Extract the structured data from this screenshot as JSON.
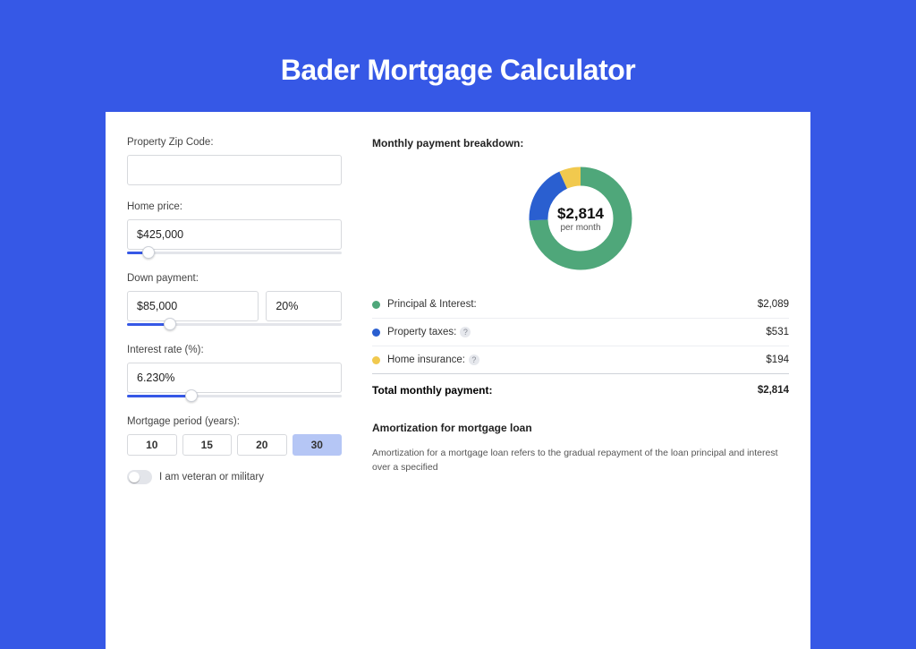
{
  "title": "Bader Mortgage Calculator",
  "form": {
    "zip_label": "Property Zip Code:",
    "zip_value": "",
    "home_price_label": "Home price:",
    "home_price_value": "$425,000",
    "home_price_slider_pct": 10,
    "down_payment_label": "Down payment:",
    "down_payment_amount": "$85,000",
    "down_payment_pct": "20%",
    "down_payment_slider_pct": 20,
    "interest_label": "Interest rate (%):",
    "interest_value": "6.230%",
    "interest_slider_pct": 30,
    "period_label": "Mortgage period (years):",
    "periods": [
      "10",
      "15",
      "20",
      "30"
    ],
    "period_selected_index": 3,
    "veteran_label": "I am veteran or military"
  },
  "breakdown": {
    "title": "Monthly payment breakdown:",
    "center_amount": "$2,814",
    "center_sub": "per month",
    "items": [
      {
        "label": "Principal & Interest:",
        "value": "$2,089",
        "color": "green"
      },
      {
        "label": "Property taxes:",
        "value": "$531",
        "color": "blue",
        "help": true
      },
      {
        "label": "Home insurance:",
        "value": "$194",
        "color": "yellow",
        "help": true
      }
    ],
    "total_label": "Total monthly payment:",
    "total_value": "$2,814"
  },
  "amort": {
    "title": "Amortization for mortgage loan",
    "text": "Amortization for a mortgage loan refers to the gradual repayment of the loan principal and interest over a specified"
  },
  "chart_data": {
    "type": "pie",
    "title": "Monthly payment breakdown",
    "series": [
      {
        "name": "Principal & Interest",
        "value": 2089,
        "color": "#4fa77a"
      },
      {
        "name": "Property taxes",
        "value": 531,
        "color": "#2a5fd0"
      },
      {
        "name": "Home insurance",
        "value": 194,
        "color": "#f1c94e"
      }
    ],
    "total": 2814,
    "center_label": "$2,814 per month"
  }
}
